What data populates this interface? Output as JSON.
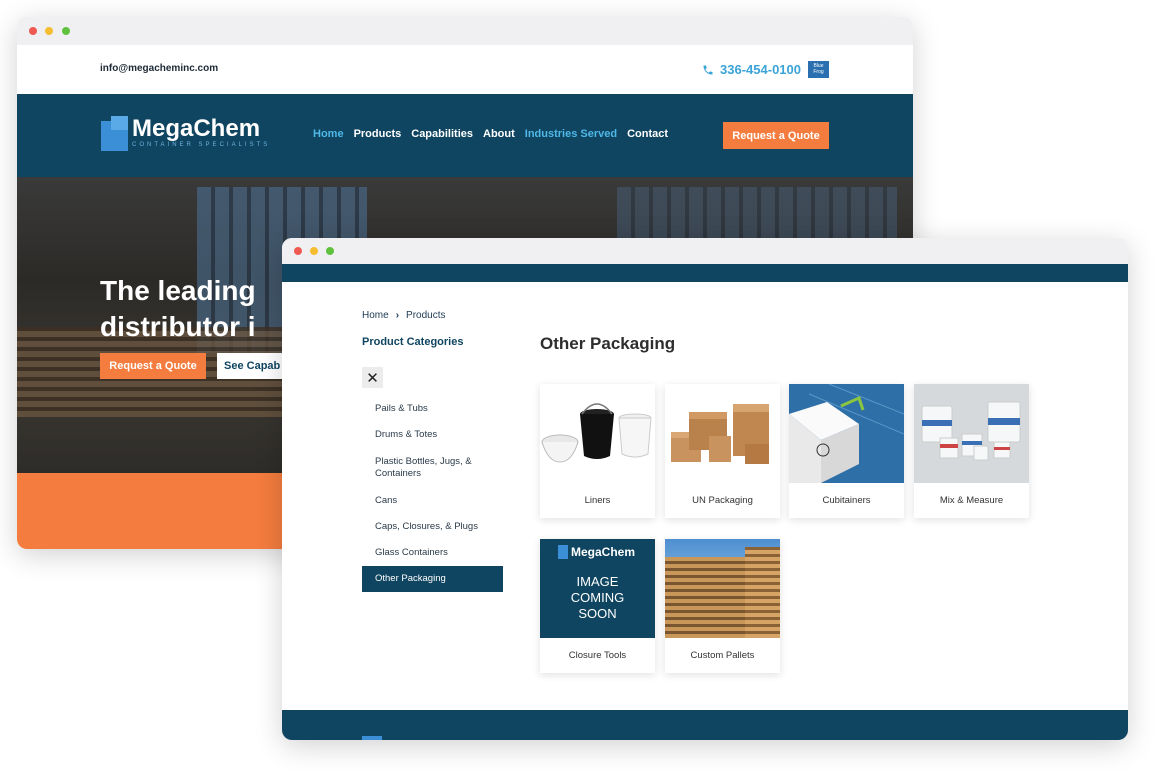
{
  "back_window": {
    "email": "info@megacheminc.com",
    "phone": "336-454-0100",
    "badge_text": "Blue Frog",
    "logo": {
      "name": "MegaChem",
      "tagline": "CONTAINER SPECIALISTS"
    },
    "nav": [
      "Home",
      "Products",
      "Capabilities",
      "About",
      "Industries Served",
      "Contact"
    ],
    "nav_active": [
      "Home",
      "Industries Served"
    ],
    "cta": "Request a Quote",
    "hero": {
      "title_line1": "The leading",
      "title_line2": "distributor i",
      "btn_primary": "Request a Quote",
      "btn_secondary": "See Capab"
    }
  },
  "front_window": {
    "breadcrumb": {
      "home": "Home",
      "separator": "›",
      "current": "Products"
    },
    "sidebar": {
      "title": "Product Categories",
      "close_glyph": "✕",
      "items": [
        "Pails & Tubs",
        "Drums & Totes",
        "Plastic Bottles, Jugs, & Containers",
        "Cans",
        "Caps, Closures, & Plugs",
        "Glass Containers",
        "Other Packaging"
      ],
      "selected": "Other Packaging"
    },
    "page_title": "Other Packaging",
    "products": [
      {
        "label": "Liners",
        "icon": "liners-image"
      },
      {
        "label": "UN Packaging",
        "icon": "boxes-image"
      },
      {
        "label": "Cubitainers",
        "icon": "cubitainer-image"
      },
      {
        "label": "Mix & Measure",
        "icon": "tubs-image"
      },
      {
        "label": "Closure Tools",
        "icon": "placeholder-image",
        "placeholder": {
          "brand": "MegaChem",
          "l1": "IMAGE",
          "l2": "COMING",
          "l3": "SOON"
        }
      },
      {
        "label": "Custom Pallets",
        "icon": "pallets-image"
      }
    ]
  },
  "colors": {
    "navy": "#0f4560",
    "orange": "#f37c3e",
    "accent_blue": "#4fb8e8"
  }
}
